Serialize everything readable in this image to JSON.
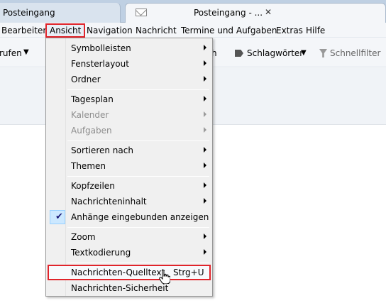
{
  "tabs": [
    {
      "label": "Posteingang"
    },
    {
      "label": "Posteingang - ..."
    }
  ],
  "menubar": [
    {
      "label": "Bearbeiten"
    },
    {
      "label": "Ansicht"
    },
    {
      "label": "Navigation"
    },
    {
      "label": "Nachricht"
    },
    {
      "label": "Termine und Aufgaben"
    },
    {
      "label": "Extras"
    },
    {
      "label": "Hilfe"
    }
  ],
  "toolbar": {
    "left_label": "rufen",
    "right_stub": "h",
    "tags_label": "Schlagwörter",
    "quickfilter_label": "Schnellfilter"
  },
  "dropdown": {
    "items": [
      {
        "label": "Symbolleisten",
        "submenu": true
      },
      {
        "label": "Fensterlayout",
        "submenu": true
      },
      {
        "label": "Ordner",
        "submenu": true
      },
      {
        "label": "Tagesplan",
        "submenu": true
      },
      {
        "label": "Kalender",
        "submenu": true,
        "disabled": true
      },
      {
        "label": "Aufgaben",
        "submenu": true,
        "disabled": true
      },
      {
        "label": "Sortieren nach",
        "submenu": true
      },
      {
        "label": "Themen",
        "submenu": true
      },
      {
        "label": "Kopfzeilen",
        "submenu": true
      },
      {
        "label": "Nachrichteninhalt",
        "submenu": true
      },
      {
        "label": "Anhänge eingebunden anzeigen",
        "checked": true
      },
      {
        "label": "Zoom",
        "submenu": true
      },
      {
        "label": "Textkodierung",
        "submenu": true
      },
      {
        "label": "Nachrichten-Quelltext",
        "shortcut": "Strg+U"
      },
      {
        "label": "Nachrichten-Sicherheit"
      }
    ]
  },
  "colors": {
    "highlight_border": "#e0242b",
    "check_background": "#cce8ff"
  }
}
